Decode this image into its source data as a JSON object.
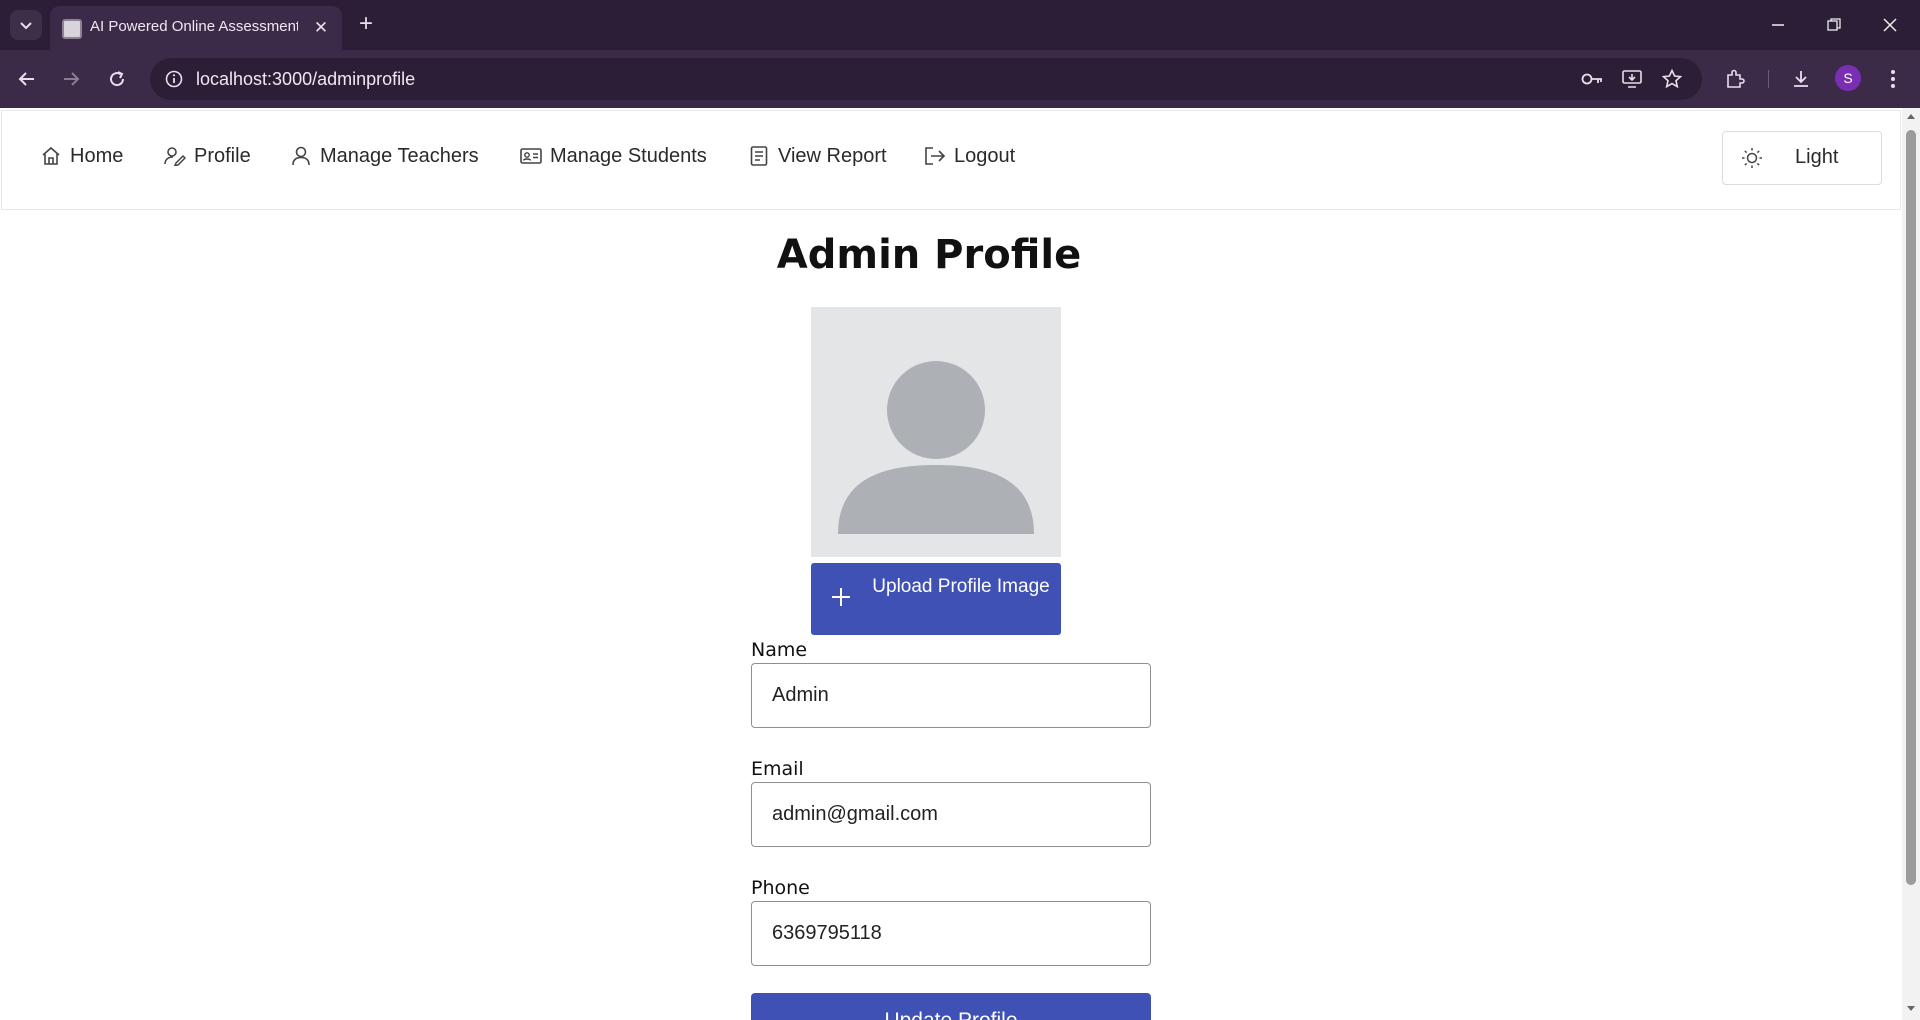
{
  "browser": {
    "tab_title": "AI Powered Online Assessment",
    "url": "localhost:3000/adminprofile",
    "profile_initial": "S",
    "accent_color": "#3c2b48"
  },
  "nav": {
    "items": [
      {
        "label": "Home",
        "icon": "home-icon"
      },
      {
        "label": "Profile",
        "icon": "profile-edit-icon"
      },
      {
        "label": "Manage Teachers",
        "icon": "user-icon"
      },
      {
        "label": "Manage Students",
        "icon": "id-card-icon"
      },
      {
        "label": "View Report",
        "icon": "report-icon"
      },
      {
        "label": "Logout",
        "icon": "logout-icon"
      }
    ],
    "theme_label": "Light"
  },
  "page": {
    "title": "Admin Profile",
    "upload_label": "Upload Profile Image",
    "primary_color": "#3f51b5"
  },
  "form": {
    "name_label": "Name",
    "name_value": "Admin",
    "email_label": "Email",
    "email_value": "admin@gmail.com",
    "phone_label": "Phone",
    "phone_value": "6369795118",
    "update_label": "Update Profile"
  }
}
